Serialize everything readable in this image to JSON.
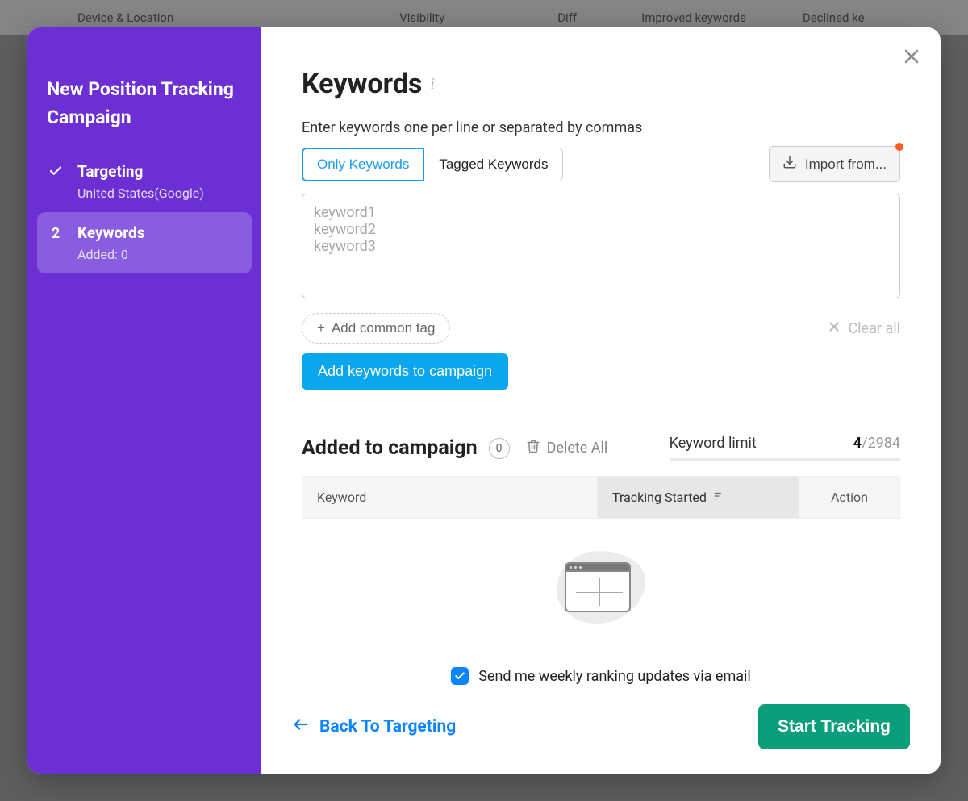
{
  "background_columns": [
    "Device & Location",
    "Visibility",
    "Diff",
    "Improved keywords",
    "Declined ke"
  ],
  "sidebar": {
    "title": "New Position Tracking Campaign",
    "steps": [
      {
        "mark": "✓",
        "name": "Targeting",
        "sub": "United States(Google)",
        "active": false
      },
      {
        "mark": "2",
        "name": "Keywords",
        "sub": "Added: 0",
        "active": true
      }
    ]
  },
  "page": {
    "title": "Keywords",
    "hint": "Enter keywords one per line or separated by commas",
    "tabs": {
      "only": "Only Keywords",
      "tagged": "Tagged Keywords"
    },
    "import_label": "Import from...",
    "textarea_placeholder": "keyword1\nkeyword2\nkeyword3",
    "add_tag": "Add common tag",
    "clear_all": "Clear all",
    "add_keywords": "Add keywords to campaign",
    "added_title": "Added to campaign",
    "added_count": "0",
    "delete_all": "Delete All",
    "limit_label": "Keyword limit",
    "limit_used": "4",
    "limit_sep": "/",
    "limit_max": "2984",
    "table": {
      "col_keyword": "Keyword",
      "col_tracking": "Tracking Started",
      "col_action": "Action"
    }
  },
  "footer": {
    "weekly": "Send me weekly ranking updates via email",
    "back": "Back To Targeting",
    "start": "Start Tracking"
  }
}
